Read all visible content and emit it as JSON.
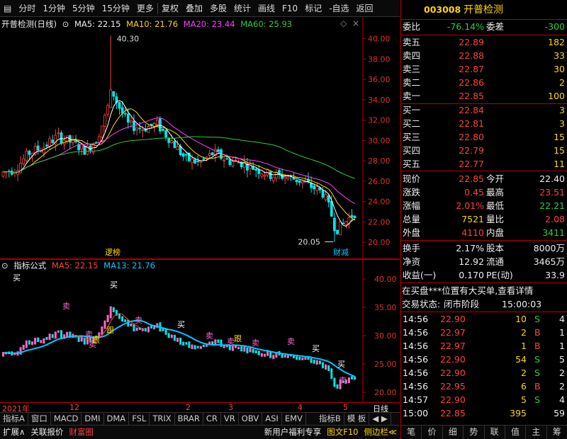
{
  "toolbar": {
    "items": [
      "分时",
      "1分钟",
      "5分钟",
      "15分钟",
      "更多",
      "复权",
      "叠加",
      "多股",
      "统计",
      "画线",
      "F10",
      "标记",
      "-自选",
      "返回"
    ]
  },
  "main_chart": {
    "stock_label": "开普检测(日线)",
    "ma5": "MA5: 22.15",
    "ma10": "MA10: 21.76",
    "ma20": "MA20: 23.44",
    "ma60": "MA60: 25.93",
    "y_ticks": [
      "40.00",
      "38.00",
      "36.00",
      "34.00",
      "32.00",
      "30.00",
      "28.00",
      "26.00",
      "24.00",
      "22.00",
      "20.00"
    ],
    "high_label": "40.30",
    "low_label": "20.05",
    "tag_left": "逻榜",
    "tag_right": "财减"
  },
  "indicator": {
    "label": "指标公式",
    "ma5": "MA5: 22.15",
    "ma13": "MA13: 21.76",
    "y_ticks": [
      "40.00",
      "35.00",
      "30.00",
      "25.00",
      "20.00"
    ],
    "annotations": [
      "买",
      "卖",
      "卖",
      "卖",
      "跟",
      "跟",
      "卖",
      "买",
      "卖",
      "卖",
      "跟",
      "卖",
      "卖",
      "买",
      "买",
      "卖",
      "买"
    ]
  },
  "time_axis": {
    "labels": [
      "2021年",
      "12",
      "2",
      "3",
      "4",
      "5",
      "日线"
    ]
  },
  "tabs_row1": [
    "指标A",
    "窗口",
    "MACD",
    "DMI",
    "DMA",
    "FSL",
    "TRIX",
    "BRAR",
    "CR",
    "VR",
    "OBV",
    "ASI",
    "EMV",
    "指标B",
    "模 板",
    "◀ ▶"
  ],
  "tabs_row2": [
    "扩展∧",
    "关联报价",
    "财富圈",
    "新用户福利专享",
    "图文F10",
    "侧边栏≪"
  ],
  "quote": {
    "code": "003008",
    "name": "开普检测",
    "weibi_label": "委比",
    "weibi": "-76.14%",
    "weicha_label": "委差",
    "weicha": "-300",
    "asks": [
      {
        "label": "卖五",
        "price": "22.89",
        "vol": "182"
      },
      {
        "label": "卖四",
        "price": "22.88",
        "vol": "33"
      },
      {
        "label": "卖三",
        "price": "22.87",
        "vol": "30"
      },
      {
        "label": "卖二",
        "price": "22.86",
        "vol": "2"
      },
      {
        "label": "卖一",
        "price": "22.85",
        "vol": "100"
      }
    ],
    "bids": [
      {
        "label": "买一",
        "price": "22.84",
        "vol": "3"
      },
      {
        "label": "买二",
        "price": "22.81",
        "vol": "3"
      },
      {
        "label": "买三",
        "price": "22.80",
        "vol": "15"
      },
      {
        "label": "买四",
        "price": "22.79",
        "vol": "15"
      },
      {
        "label": "买五",
        "price": "22.77",
        "vol": "11"
      }
    ],
    "stats": [
      {
        "l1": "现价",
        "v1": "22.85",
        "l2": "今开",
        "v2": "22.40"
      },
      {
        "l1": "涨跌",
        "v1": "0.45",
        "l2": "最高",
        "v2": "23.51"
      },
      {
        "l1": "涨幅",
        "v1": "2.01%",
        "l2": "最低",
        "v2": "22.21"
      },
      {
        "l1": "总量",
        "v1": "7521",
        "l2": "量比",
        "v2": "2.08"
      },
      {
        "l1": "外盘",
        "v1": "4110",
        "l2": "内盘",
        "v2": "3411"
      }
    ],
    "stats2": [
      {
        "l1": "换手",
        "v1": "2.17%",
        "l2": "股本",
        "v2": "8000万"
      },
      {
        "l1": "净资",
        "v1": "12.92",
        "l2": "流通",
        "v2": "3465万"
      },
      {
        "l1": "收益(一)",
        "v1": "0.170",
        "l2": "PE(动)",
        "v2": "33.9"
      }
    ],
    "notice": "在买盘***位置有大买单,查看详情",
    "trade_status_label": "交易状态:",
    "trade_status": "闭市阶段",
    "trade_time": "15:00:03",
    "ticks": [
      {
        "time": "14:56",
        "price": "22.90",
        "vol": "10",
        "side": "S",
        "n": "4"
      },
      {
        "time": "14:56",
        "price": "22.97",
        "vol": "2",
        "side": "B",
        "n": "1"
      },
      {
        "time": "14:56",
        "price": "22.97",
        "vol": "1",
        "side": "B",
        "n": "1"
      },
      {
        "time": "14:56",
        "price": "22.90",
        "vol": "54",
        "side": "S",
        "n": "5"
      },
      {
        "time": "14:56",
        "price": "22.90",
        "vol": "2",
        "side": "S",
        "n": "2"
      },
      {
        "time": "14:56",
        "price": "22.95",
        "vol": "6",
        "side": "B",
        "n": "2"
      },
      {
        "time": "14:57",
        "price": "22.90",
        "vol": "5",
        "side": "S",
        "n": "4"
      },
      {
        "time": "15:00",
        "price": "22.85",
        "vol": "395",
        "side": "",
        "n": "59"
      }
    ],
    "bottom_tabs": [
      "笔",
      "价",
      "细",
      "势",
      "联",
      "值",
      "主",
      "筹"
    ]
  },
  "colors": {
    "up": "#ff4040",
    "down": "#00e5e5",
    "ma5": "#ffffff",
    "ma10": "#ffd700",
    "ma20": "#ff40ff",
    "ma60": "#2ecc40"
  }
}
